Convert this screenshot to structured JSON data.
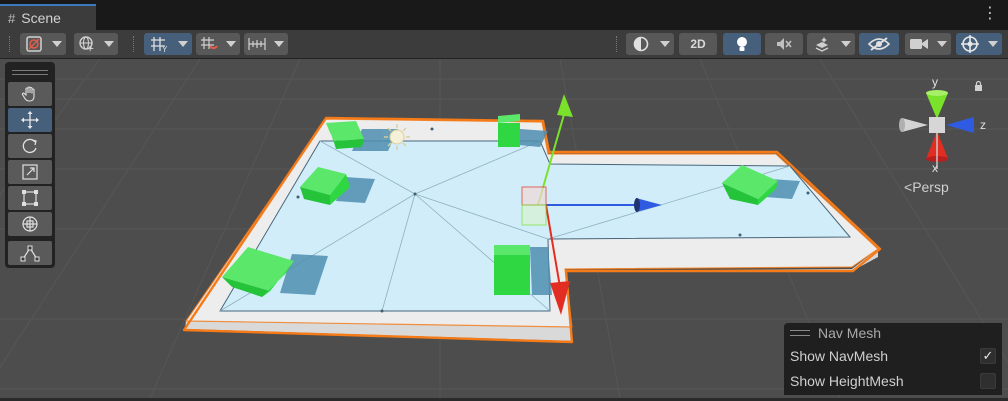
{
  "tab": {
    "title": "Scene",
    "glyph": "#",
    "menu_glyph": "⋮"
  },
  "toolbar": {
    "btn_2d_label": "2D",
    "icons": [
      "draw-mode-icon",
      "globe-icon",
      "grid-snap-icon",
      "snap-increment-icon",
      "ruler-icon",
      "shading-mode-icon",
      "lighting-icon",
      "audio-mute-icon",
      "effects-icon",
      "scene-visibility-icon",
      "camera-icon",
      "gizmos-icon"
    ]
  },
  "tools": [
    "hand-tool",
    "move-tool",
    "rotate-tool",
    "scale-tool",
    "rect-tool",
    "transform-tool",
    "custom-tool"
  ],
  "gizmo": {
    "axis_y": "y",
    "axis_z": "z",
    "axis_x": "x",
    "projection_label": "Persp"
  },
  "nav_mesh": {
    "title": "Nav Mesh",
    "show_navmesh_label": "Show NavMesh",
    "show_navmesh_checked": true,
    "show_navmesh_mark": "✓",
    "show_heightmesh_label": "Show HeightMesh",
    "show_heightmesh_checked": false
  },
  "colors": {
    "accent": "#3a79bb",
    "active_button": "#46607c",
    "selection_outline": "#f57a18",
    "navmesh_fill": "#cfeefa",
    "cube_green": "#2fd843",
    "axis_x_red": "#e22e22",
    "axis_y_green": "#7ae22a",
    "axis_z_blue": "#2e5be2"
  }
}
